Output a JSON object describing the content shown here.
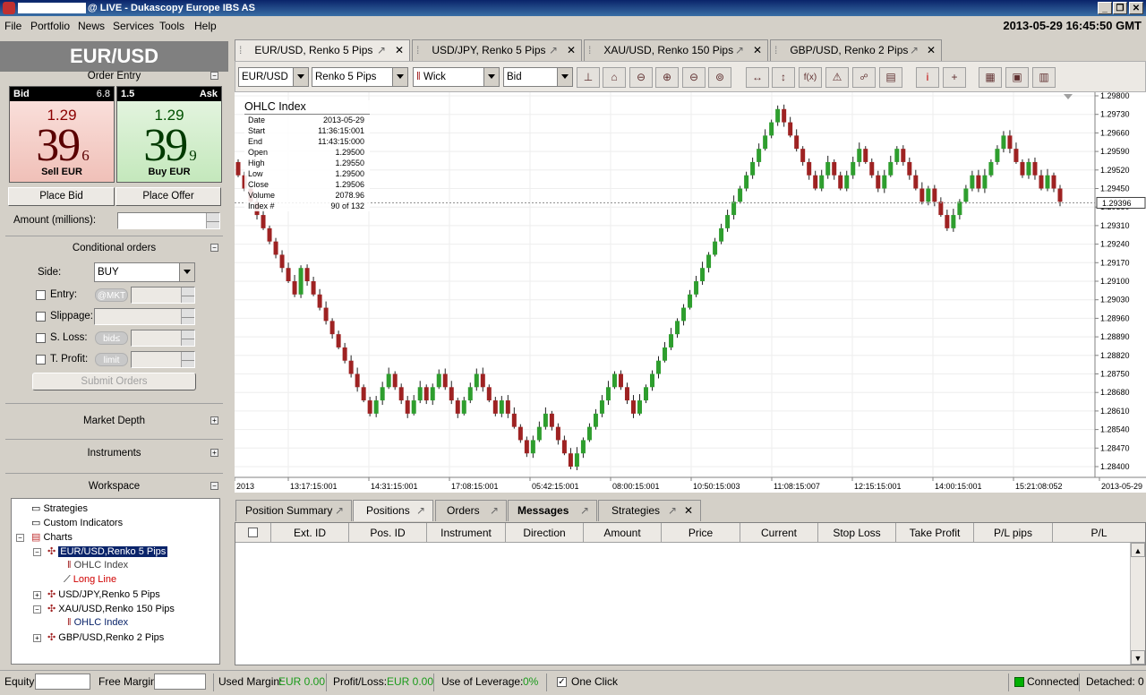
{
  "window": {
    "title": "@ LIVE - Dukascopy Europe IBS AS",
    "min": "_",
    "max": "❐",
    "close": "✕"
  },
  "menu": [
    "File",
    "Portfolio",
    "News",
    "Services",
    "Tools",
    "Help"
  ],
  "clock": "2013-05-29 16:45:50 GMT",
  "instrument": "EUR/USD",
  "order_entry": {
    "title": "Order Entry",
    "bid_label": "Bid",
    "bid_spread": "6.8",
    "ask_spread": "1.5",
    "ask_label": "Ask",
    "bid_big": "1.29",
    "bid_main": "39",
    "bid_pip": "6",
    "sell": "Sell EUR",
    "ask_big": "1.29",
    "ask_main": "39",
    "ask_pip": "9",
    "buy": "Buy EUR",
    "place_bid": "Place Bid",
    "place_offer": "Place Offer",
    "amount_label": "Amount (millions):"
  },
  "conditional": {
    "title": "Conditional orders",
    "side_label": "Side:",
    "side_value": "BUY",
    "entry": "Entry:",
    "entry_pill": "@MKT",
    "slippage": "Slippage:",
    "sloss": "S. Loss:",
    "sloss_pill": "bid≤",
    "tprofit": "T. Profit:",
    "tprofit_pill": "limit",
    "submit": "Submit Orders"
  },
  "sections": {
    "market_depth": "Market Depth",
    "instruments": "Instruments",
    "workspace": "Workspace"
  },
  "tree": {
    "strategies": "Strategies",
    "custom": "Custom Indicators",
    "charts": "Charts",
    "eurusd": "EUR/USD,Renko 5 Pips",
    "ohlc1": "OHLC Index",
    "longline": "Long Line",
    "usdjpy": "USD/JPY,Renko 5 Pips",
    "xauusd": "XAU/USD,Renko 150 Pips",
    "ohlc2": "OHLC Index",
    "gbpusd": "GBP/USD,Renko 2 Pips"
  },
  "chart_tabs": [
    "EUR/USD, Renko 5 Pips",
    "USD/JPY, Renko 5 Pips",
    "XAU/USD, Renko 150 Pips",
    "GBP/USD, Renko 2 Pips"
  ],
  "toolbar": {
    "instrument": "EUR/USD",
    "period": "Renko 5 Pips",
    "style": "Wick",
    "side": "Bid"
  },
  "ohlc": {
    "title": "OHLC Index",
    "rows": [
      [
        "Date",
        "2013-05-29"
      ],
      [
        "Start",
        "11:36:15:001"
      ],
      [
        "End",
        "11:43:15:000"
      ],
      [
        "Open",
        "1.29500"
      ],
      [
        "High",
        "1.29550"
      ],
      [
        "Low",
        "1.29500"
      ],
      [
        "Close",
        "1.29506"
      ],
      [
        "Volume",
        "2078.96"
      ],
      [
        "Index #",
        "90 of 132"
      ]
    ]
  },
  "chart_data": {
    "type": "candlestick",
    "y_ticks": [
      "1.29800",
      "1.29730",
      "1.29660",
      "1.29590",
      "1.29520",
      "1.29450",
      "1.29380",
      "1.29310",
      "1.29240",
      "1.29170",
      "1.29100",
      "1.29030",
      "1.28960",
      "1.28890",
      "1.28820",
      "1.28750",
      "1.28680",
      "1.28610",
      "1.28540",
      "1.28470",
      "1.28400"
    ],
    "x_ticks": [
      "2013",
      "13:17:15:001",
      "14:31:15:001",
      "17:08:15:001",
      "05:42:15:001",
      "08:00:15:001",
      "10:50:15:003",
      "11:08:15:007",
      "12:15:15:001",
      "14:00:15:001",
      "15:21:08:052",
      "2013-05-29"
    ],
    "current_price": "1.29396",
    "ylim": [
      1.284,
      1.298
    ],
    "closes": [
      1.295,
      1.2945,
      1.294,
      1.2935,
      1.293,
      1.2925,
      1.292,
      1.2915,
      1.291,
      1.2905,
      1.2915,
      1.291,
      1.2905,
      1.29,
      1.2895,
      1.289,
      1.2885,
      1.288,
      1.2875,
      1.287,
      1.2865,
      1.286,
      1.2865,
      1.287,
      1.2875,
      1.287,
      1.2865,
      1.286,
      1.2865,
      1.287,
      1.2865,
      1.287,
      1.2875,
      1.287,
      1.2865,
      1.286,
      1.2865,
      1.287,
      1.2875,
      1.287,
      1.2865,
      1.286,
      1.2865,
      1.286,
      1.2855,
      1.285,
      1.2845,
      1.285,
      1.2855,
      1.286,
      1.2855,
      1.285,
      1.2845,
      1.284,
      1.2845,
      1.285,
      1.2855,
      1.286,
      1.2865,
      1.287,
      1.2875,
      1.287,
      1.2865,
      1.286,
      1.2865,
      1.287,
      1.2875,
      1.288,
      1.2885,
      1.289,
      1.2895,
      1.29,
      1.2905,
      1.291,
      1.2915,
      1.292,
      1.2925,
      1.293,
      1.2935,
      1.294,
      1.2945,
      1.295,
      1.2955,
      1.296,
      1.2965,
      1.297,
      1.2975,
      1.297,
      1.2965,
      1.296,
      1.2955,
      1.295,
      1.2945,
      1.295,
      1.2955,
      1.295,
      1.2945,
      1.295,
      1.2955,
      1.296,
      1.2955,
      1.295,
      1.2945,
      1.295,
      1.2955,
      1.296,
      1.2955,
      1.295,
      1.2945,
      1.294,
      1.2945,
      1.294,
      1.2935,
      1.293,
      1.2935,
      1.294,
      1.2945,
      1.295,
      1.2945,
      1.295,
      1.2955,
      1.296,
      1.2965,
      1.296,
      1.2955,
      1.295,
      1.2955,
      1.295,
      1.2945,
      1.295,
      1.2945,
      1.294
    ]
  },
  "bottom_tabs": [
    "Position Summary",
    "Positions",
    "Orders",
    "Messages",
    "Strategies"
  ],
  "columns": [
    "Ext. ID",
    "Pos. ID",
    "Instrument",
    "Direction",
    "Amount",
    "Price",
    "Current",
    "Stop Loss",
    "Take Profit",
    "P/L pips",
    "P/L"
  ],
  "status": {
    "equity": "Equity:",
    "free_margin": "Free Margin:",
    "used_margin": "Used Margin:",
    "used_margin_val": "EUR 0.00",
    "pl": "Profit/Loss:",
    "pl_val": "EUR 0.00",
    "leverage": "Use of Leverage:",
    "leverage_val": "0%",
    "one_click": "One Click",
    "connected": "Connected",
    "detached": "Detached: 0"
  }
}
